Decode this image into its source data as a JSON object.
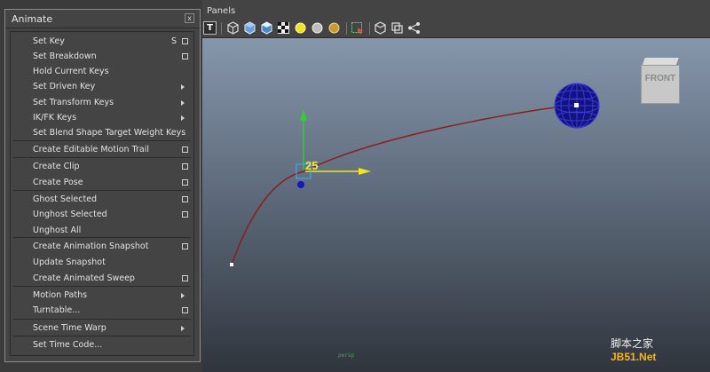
{
  "menu": {
    "title": "Animate",
    "close_glyph": "x",
    "items": [
      {
        "label": "Set Key",
        "shortcut": "S",
        "option_box": true,
        "submenu": false
      },
      {
        "label": "Set Breakdown",
        "shortcut": "",
        "option_box": true,
        "submenu": false
      },
      {
        "label": "Hold Current Keys",
        "shortcut": "",
        "option_box": false,
        "submenu": false
      },
      {
        "label": "Set Driven Key",
        "shortcut": "",
        "option_box": false,
        "submenu": true
      },
      {
        "label": "Set Transform Keys",
        "shortcut": "",
        "option_box": false,
        "submenu": true
      },
      {
        "label": "IK/FK Keys",
        "shortcut": "",
        "option_box": false,
        "submenu": true
      },
      {
        "label": "Set Blend Shape Target Weight Keys",
        "shortcut": "",
        "option_box": false,
        "submenu": false
      },
      {
        "label": "Create Editable Motion Trail",
        "shortcut": "",
        "option_box": true,
        "submenu": false
      },
      {
        "label": "Create Clip",
        "shortcut": "",
        "option_box": true,
        "submenu": false
      },
      {
        "label": "Create Pose",
        "shortcut": "",
        "option_box": true,
        "submenu": false
      },
      {
        "label": "Ghost Selected",
        "shortcut": "",
        "option_box": true,
        "submenu": false
      },
      {
        "label": "Unghost Selected",
        "shortcut": "",
        "option_box": true,
        "submenu": false
      },
      {
        "label": "Unghost All",
        "shortcut": "",
        "option_box": false,
        "submenu": false
      },
      {
        "label": "Create Animation Snapshot",
        "shortcut": "",
        "option_box": true,
        "submenu": false
      },
      {
        "label": "Update Snapshot",
        "shortcut": "",
        "option_box": false,
        "submenu": false
      },
      {
        "label": "Create Animated Sweep",
        "shortcut": "",
        "option_box": true,
        "submenu": false
      },
      {
        "label": "Motion Paths",
        "shortcut": "",
        "option_box": false,
        "submenu": true
      },
      {
        "label": "Turntable...",
        "shortcut": "",
        "option_box": true,
        "submenu": false
      },
      {
        "label": "Scene Time Warp",
        "shortcut": "",
        "option_box": false,
        "submenu": true
      },
      {
        "label": "Set Time Code...",
        "shortcut": "",
        "option_box": false,
        "submenu": false
      }
    ]
  },
  "panel": {
    "menu_label": "Panels",
    "toolbar_icons": [
      "text-icon",
      "wireframe-cube-icon",
      "shaded-cube-icon",
      "textured-cube-icon",
      "checker-icon",
      "light-yellow-icon",
      "light-gray-icon",
      "light-gold-icon",
      "select-region-icon",
      "isolate-icon",
      "xray-icon",
      "share-icon"
    ]
  },
  "viewport": {
    "current_frame": "25",
    "view_cube_label": "FRONT",
    "camera_label": "persp",
    "colors": {
      "trail": "#8b1e1e",
      "sphere": "#1414a0",
      "manip_y": "#2fd12f",
      "manip_x": "#f2e41c",
      "frame": "#f0e84a"
    }
  },
  "watermark": {
    "line1": "脚本之家",
    "line2": "JB51.Net"
  }
}
